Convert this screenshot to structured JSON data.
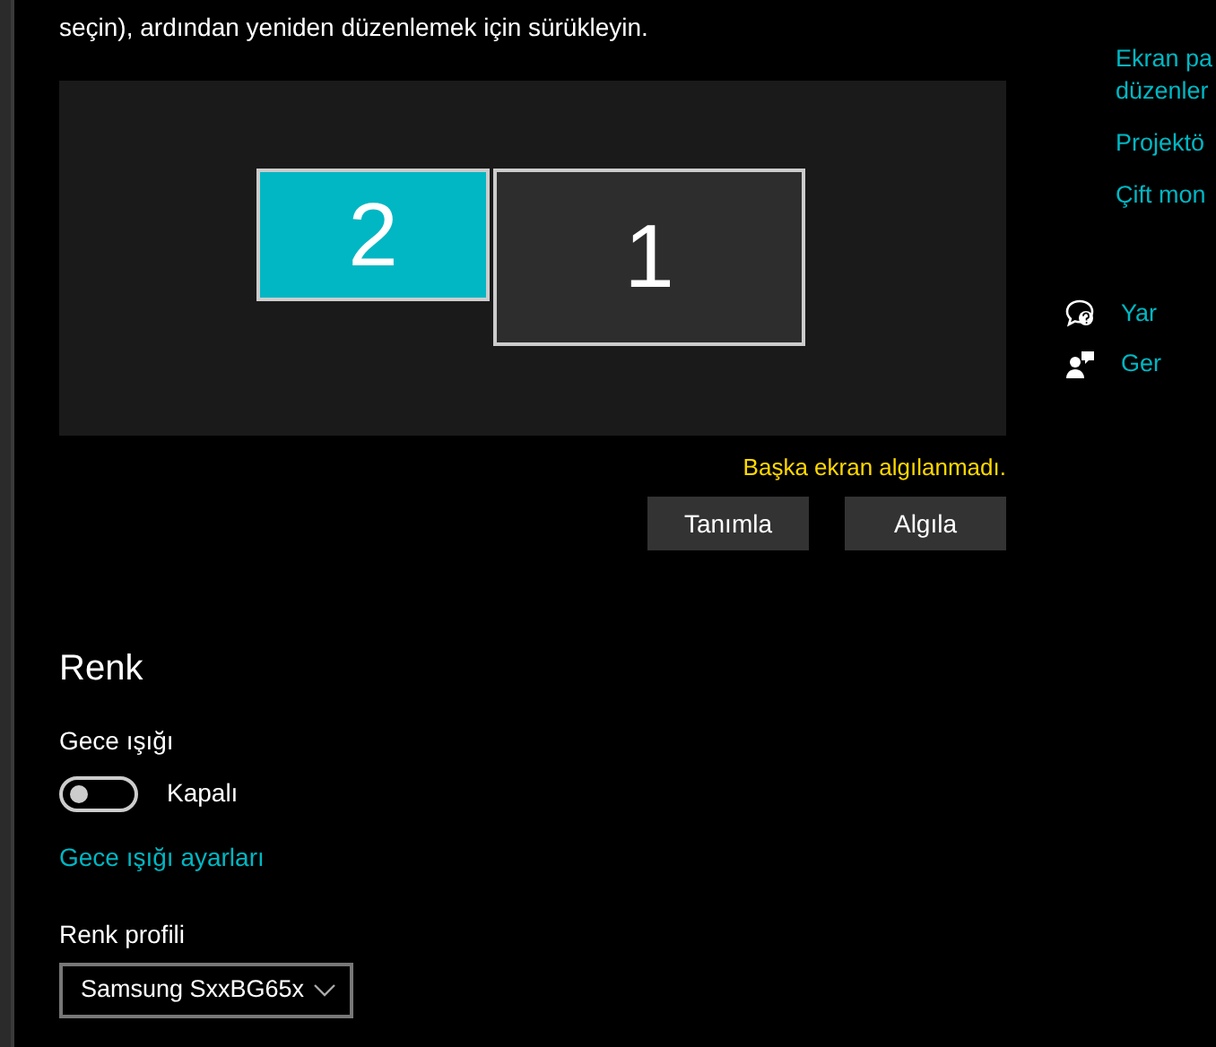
{
  "instructions": "seçin), ardından yeniden düzenlemek için sürükleyin.",
  "displays": [
    {
      "number": "2",
      "selected": true
    },
    {
      "number": "1",
      "selected": false
    }
  ],
  "status": "Başka ekran algılanmadı.",
  "buttons": [
    "Tanımla",
    "Algıla"
  ],
  "section_title": "Renk",
  "night_light": {
    "label": "Gece ışığı",
    "on": false,
    "state_text": "Kapalı"
  },
  "night_light_link": "Gece ışığı ayarları",
  "color_profile": {
    "label": "Renk profili",
    "value": "Samsung SxxBG65x"
  },
  "related_links": [
    {
      "lines": [
        "Ekran pa",
        "düzenler"
      ]
    },
    {
      "lines": [
        "Projektö"
      ]
    },
    {
      "lines": [
        "Çift mon"
      ]
    }
  ],
  "help_links": [
    {
      "kind": "help",
      "text": "Yar"
    },
    {
      "kind": "feedback",
      "text": "Ger"
    }
  ]
}
